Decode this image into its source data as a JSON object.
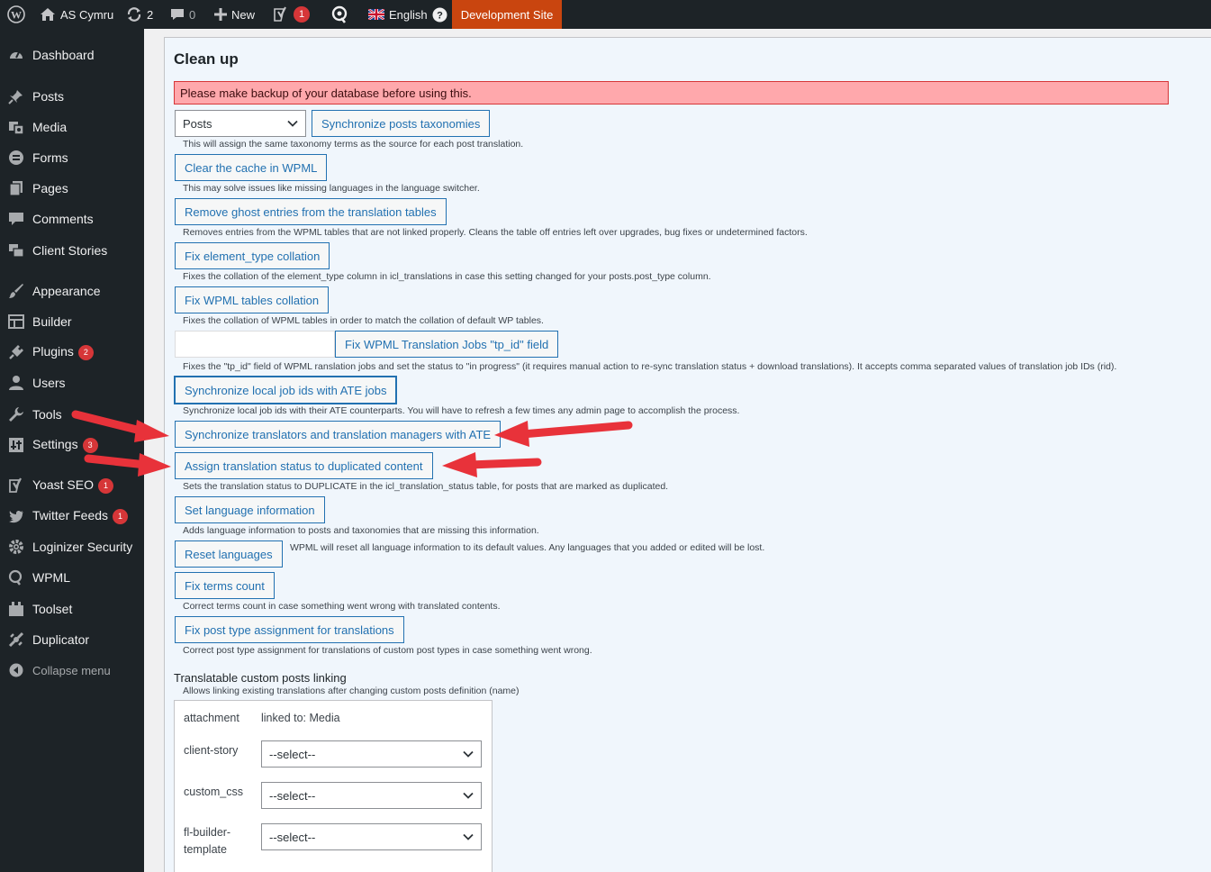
{
  "admin_bar": {
    "site_name": "AS Cymru",
    "updates_count": "2",
    "comments_count": "0",
    "new_label": "New",
    "yoast_badge": "1",
    "language_label": "English",
    "environment_label": "Development Site"
  },
  "sidebar": {
    "items": [
      {
        "label": "Dashboard",
        "icon": "dashboard-icon",
        "badge": ""
      },
      {
        "label": "Posts",
        "icon": "pin-icon",
        "badge": ""
      },
      {
        "label": "Media",
        "icon": "media-icon",
        "badge": ""
      },
      {
        "label": "Forms",
        "icon": "forms-icon",
        "badge": ""
      },
      {
        "label": "Pages",
        "icon": "pages-icon",
        "badge": ""
      },
      {
        "label": "Comments",
        "icon": "comment-icon",
        "badge": ""
      },
      {
        "label": "Client Stories",
        "icon": "stories-icon",
        "badge": ""
      },
      {
        "label": "Appearance",
        "icon": "brush-icon",
        "badge": ""
      },
      {
        "label": "Builder",
        "icon": "builder-icon",
        "badge": ""
      },
      {
        "label": "Plugins",
        "icon": "plug-icon",
        "badge": "2"
      },
      {
        "label": "Users",
        "icon": "user-icon",
        "badge": ""
      },
      {
        "label": "Tools",
        "icon": "wrench-icon",
        "badge": ""
      },
      {
        "label": "Settings",
        "icon": "settings-icon",
        "badge": "3"
      },
      {
        "label": "Yoast SEO",
        "icon": "yoast-icon",
        "badge": "1"
      },
      {
        "label": "Twitter Feeds",
        "icon": "twitter-icon",
        "badge": "1"
      },
      {
        "label": "Loginizer Security",
        "icon": "gear-icon",
        "badge": ""
      },
      {
        "label": "WPML",
        "icon": "wpml-icon",
        "badge": ""
      },
      {
        "label": "Toolset",
        "icon": "toolset-icon",
        "badge": ""
      },
      {
        "label": "Duplicator",
        "icon": "duplicator-icon",
        "badge": ""
      }
    ],
    "collapse_label": "Collapse menu"
  },
  "main": {
    "title": "Clean up",
    "warning": "Please make backup of your database before using this.",
    "post_type_select": "Posts",
    "buttons": {
      "sync_taxonomies": "Synchronize posts taxonomies",
      "clear_cache": "Clear the cache in WPML",
      "remove_ghost": "Remove ghost entries from the translation tables",
      "fix_element_type": "Fix element_type collation",
      "fix_tables_collation": "Fix WPML tables collation",
      "fix_tp_id": "Fix WPML Translation Jobs \"tp_id\" field",
      "sync_job_ids": "Synchronize local job ids with ATE jobs",
      "sync_translators": "Synchronize translators and translation managers with ATE",
      "assign_status": "Assign translation status to duplicated content",
      "set_language": "Set language information",
      "reset_languages": "Reset languages",
      "fix_terms": "Fix terms count",
      "fix_post_type": "Fix post type assignment for translations"
    },
    "descriptions": {
      "sync_taxonomies": "This will assign the same taxonomy terms as the source for each post translation.",
      "clear_cache": "This may solve issues like missing languages in the language switcher.",
      "remove_ghost": "Removes entries from the WPML tables that are not linked properly. Cleans the table off entries left over upgrades, bug fixes or undetermined factors.",
      "fix_element_type": "Fixes the collation of the element_type column in icl_translations in case this setting changed for your posts.post_type column.",
      "fix_tables_collation": "Fixes the collation of WPML tables in order to match the collation of default WP tables.",
      "fix_tp_id": "Fixes the \"tp_id\" field of WPML ranslation jobs and set the status to \"in progress\" (it requires manual action to re-sync translation status + download translations). It accepts comma separated values of translation job IDs (rid).",
      "sync_job_ids": "Synchronize local job ids with their ATE counterparts. You will have to refresh a few times any admin page to accomplish the process.",
      "assign_status": "Sets the translation status to DUPLICATE in the icl_translation_status table, for posts that are marked as duplicated.",
      "set_language": "Adds language information to posts and taxonomies that are missing this information.",
      "reset_languages": "WPML will reset all language information to its default values. Any languages that you added or edited will be lost.",
      "fix_terms": "Correct terms count in case something went wrong with translated contents.",
      "fix_post_type": "Correct post type assignment for translations of custom post types in case something went wrong."
    },
    "linking": {
      "title": "Translatable custom posts linking",
      "subtitle": "Allows linking existing translations after changing custom posts definition (name)",
      "attachment_label": "attachment",
      "attachment_value": "linked to: Media",
      "rows": [
        {
          "label": "client-story",
          "select": "--select--"
        },
        {
          "label": "custom_css",
          "select": "--select--"
        },
        {
          "label_line1": "fl-builder-",
          "label_line2": "template",
          "select": "--select--"
        }
      ]
    }
  },
  "colors": {
    "admin_bg": "#1d2327",
    "accent": "#2271b1",
    "warning_bg": "#ffa8ac",
    "annotation_arrow": "#e8323a"
  }
}
